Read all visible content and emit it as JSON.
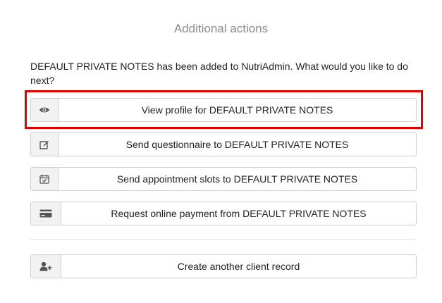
{
  "dialog": {
    "title": "Additional actions",
    "message": "DEFAULT PRIVATE NOTES has been added to NutriAdmin. What would you like to do next?"
  },
  "actions": [
    {
      "label": "View profile for DEFAULT PRIVATE NOTES",
      "icon": "eye-icon",
      "highlighted": true
    },
    {
      "label": "Send questionnaire to DEFAULT PRIVATE NOTES",
      "icon": "edit-icon"
    },
    {
      "label": "Send appointment slots to DEFAULT PRIVATE NOTES",
      "icon": "calendar-check-icon"
    },
    {
      "label": "Request online payment from DEFAULT PRIVATE NOTES",
      "icon": "credit-card-icon"
    },
    {
      "label": "Create another client record",
      "icon": "user-plus-icon"
    }
  ],
  "colors": {
    "highlight": "#e00000",
    "button_border": "#cfcfcf",
    "icon_bg": "#f2f2f2"
  }
}
